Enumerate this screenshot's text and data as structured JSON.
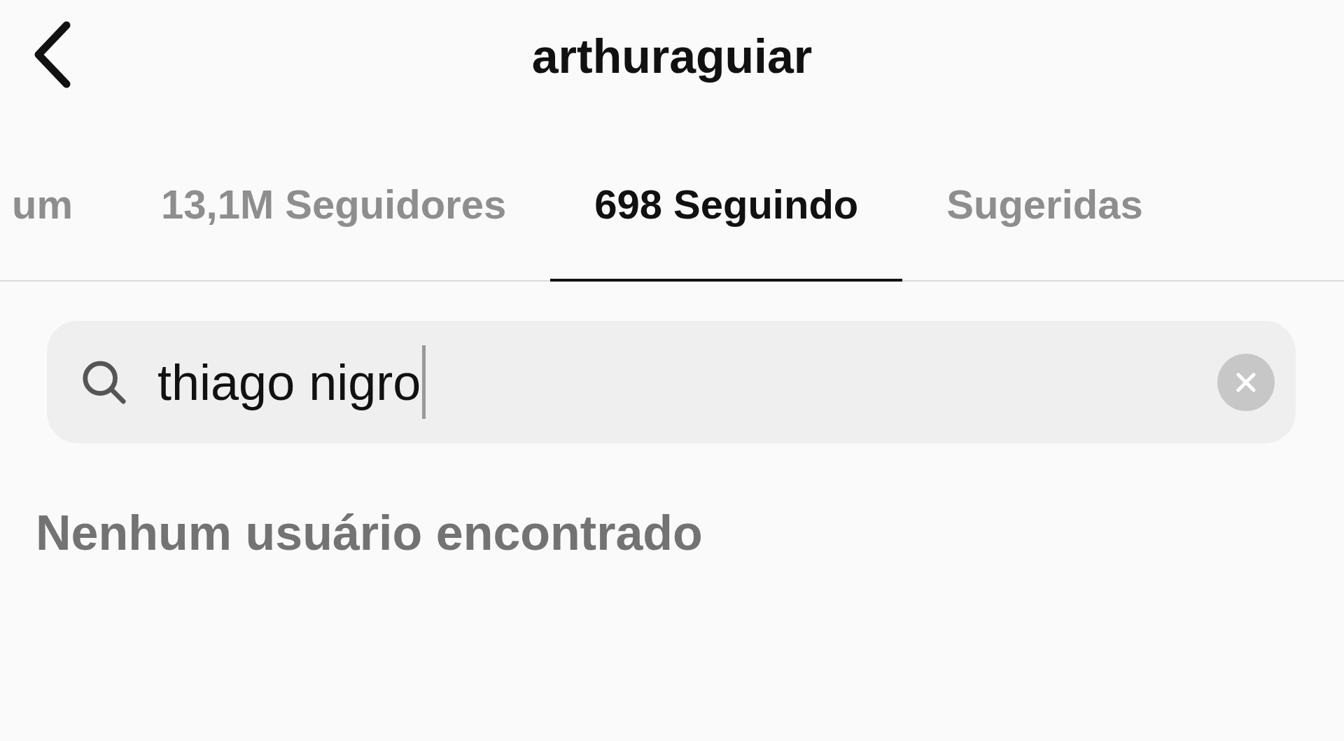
{
  "header": {
    "title": "arthuraguiar"
  },
  "tabs": [
    {
      "label": "um",
      "selected": false
    },
    {
      "label": "13,1M Seguidores",
      "selected": false
    },
    {
      "label": "698 Seguindo",
      "selected": true
    },
    {
      "label": "Sugeridas",
      "selected": false
    }
  ],
  "search": {
    "value": "thiago nigro"
  },
  "empty_message": "Nenhum usuário encontrado"
}
